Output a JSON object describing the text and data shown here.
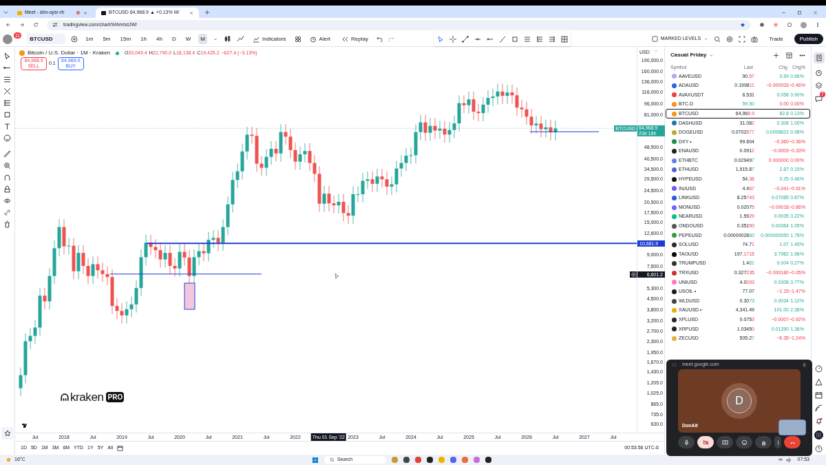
{
  "browser": {
    "tabs": [
      {
        "title": "Meet - sbn-oysr-rtr",
        "selected": false
      },
      {
        "title": "BTCUSD 64,968.9 ▲ +0.13% M/",
        "selected": true
      }
    ],
    "address": "tradingview.com/chart/94hmhdJW/"
  },
  "toolbar": {
    "avatar_badge": "11",
    "symbol": "BTCUSD",
    "intervals": [
      {
        "label": "1m",
        "selected": false
      },
      {
        "label": "5m",
        "selected": false
      },
      {
        "label": "15m",
        "selected": false
      },
      {
        "label": "1h",
        "selected": false
      },
      {
        "label": "4h",
        "selected": false
      },
      {
        "label": "D",
        "selected": false
      },
      {
        "label": "W",
        "selected": false
      },
      {
        "label": "M",
        "selected": true
      }
    ],
    "indicators": "Indicators",
    "alert": "Alert",
    "replay": "Replay",
    "layout_name": "MARKED LEVELS",
    "trade": "Trade",
    "publish": "Publish"
  },
  "chart": {
    "legend": {
      "title": "Bitcoin / U.S. Dollar · 1M · Kraken",
      "open_label": "O",
      "open": "20,049.4",
      "high_label": "H",
      "high": "22,790.0",
      "low_label": "L",
      "low": "18,138.4",
      "close_label": "C",
      "close": "19,425.2",
      "change": "−627.4 (−3.13%)"
    },
    "sell": {
      "price": "64,968.9",
      "label": "SELL"
    },
    "quantity": "0.1",
    "buy": {
      "price": "64,969.0",
      "label": "BUY"
    },
    "watermark": {
      "brand": "kraken",
      "badge": "PRO"
    },
    "currency": "USD",
    "y_ticks": [
      "190,000.0",
      "160,000.0",
      "136,000.0",
      "116,000.0",
      "96,000.0",
      "81,000.0",
      "48,500.0",
      "40,500.0",
      "34,500.0",
      "29,500.0",
      "24,500.0",
      "20,500.0",
      "17,500.0",
      "15,000.0",
      "12,600.0",
      "9,000.0",
      "7,500.0",
      "5,300.0",
      "4,500.0",
      "3,800.0",
      "3,200.0",
      "2,700.0",
      "2,300.0",
      "1,950.0",
      "1,670.0",
      "1,430.0",
      "1,205.0",
      "1,025.0",
      "865.0",
      "735.0",
      "630.0"
    ],
    "price_labels": [
      {
        "kind": "last",
        "symbol": "BTCUSD",
        "price": "64,968.9",
        "countdown": "23d 18h"
      },
      {
        "kind": "line",
        "price": "10,681.9"
      },
      {
        "kind": "cursor",
        "price": "6,601.2"
      }
    ],
    "x_ticks": [
      "Jul",
      "2018",
      "Jul",
      "2019",
      "Jul",
      "2020",
      "Jul",
      "2021",
      "Jul",
      "2022",
      "2023",
      "Jul",
      "2024",
      "Jul",
      "2025",
      "Jul",
      "2026",
      "Jul",
      "2027",
      "Jul"
    ],
    "hover_date": "Thu 01 Sep '22",
    "ranges": [
      "1D",
      "5D",
      "1M",
      "3M",
      "6M",
      "YTD",
      "1Y",
      "5Y",
      "All"
    ],
    "clock": "00:53:56 UTC-6"
  },
  "watchlist": {
    "title": "Casual Friday",
    "columns": [
      "Symbol",
      "Last",
      "Chg",
      "Chg%"
    ],
    "rows": [
      {
        "symbol": "AAVEUSD",
        "color": "#b6a7f0",
        "last": [
          {
            "text": "90."
          },
          {
            "text": "57",
            "falling": true
          }
        ],
        "chg": "0.59",
        "pct": "0.66%",
        "falling": false,
        "selected": false
      },
      {
        "symbol": "ADAUSD",
        "color": "#2563eb",
        "last": [
          {
            "text": "0.1998"
          },
          {
            "text": "11",
            "falling": true
          }
        ],
        "chg": "−0.000933",
        "pct": "−0.46%",
        "falling": true,
        "selected": false
      },
      {
        "symbol": "AVAXUSDT",
        "color": "#e84142",
        "last": [
          {
            "text": "6.531"
          }
        ],
        "chg": "0.058",
        "pct": "0.90%",
        "falling": false,
        "selected": false
      },
      {
        "symbol": "BTC.D",
        "color": "#f7931a",
        "last": [
          {
            "text": "59.50",
            "falling": false
          }
        ],
        "chg": "0.00",
        "pct": "0.00%",
        "falling": true,
        "selected": false
      },
      {
        "symbol": "BTCUSD",
        "color": "#f7931a",
        "last": [
          {
            "text": "64,96"
          },
          {
            "text": "8.9",
            "falling": true
          }
        ],
        "chg": "82.8",
        "pct": "0.13%",
        "falling": false,
        "selected": true
      },
      {
        "symbol": "DASHUSD",
        "color": "#1c75bc",
        "last": [
          {
            "text": "31.08"
          },
          {
            "text": "2",
            "falling": true
          }
        ],
        "chg": "0.308",
        "pct": "1.00%",
        "falling": false,
        "selected": false
      },
      {
        "symbol": "DOGEUSD",
        "color": "#c2a633",
        "last": [
          {
            "text": "0.0702"
          },
          {
            "text": "877",
            "falling": true
          }
        ],
        "chg": "0.0006821",
        "pct": "0.98%",
        "falling": false,
        "selected": false
      },
      {
        "symbol": "DXY •",
        "color": "#1e8c4e",
        "last": [
          {
            "text": "99.604"
          }
        ],
        "chg": "−0.360",
        "pct": "−0.36%",
        "falling": true,
        "selected": false
      },
      {
        "symbol": "ENAUSD",
        "color": "#222222",
        "last": [
          {
            "text": "0.091"
          },
          {
            "text": "2",
            "falling": true
          }
        ],
        "chg": "−0.0003",
        "pct": "−0.33%",
        "falling": true,
        "selected": false
      },
      {
        "symbol": "ETHBTC",
        "color": "#627eea",
        "last": [
          {
            "text": "0.02949"
          },
          {
            "text": "7",
            "falling": false
          }
        ],
        "chg": "0.000000",
        "pct": "0.00%",
        "falling": true,
        "selected": false
      },
      {
        "symbol": "ETHUSD",
        "color": "#4f63c8",
        "last": [
          {
            "text": "1,915.8"
          },
          {
            "text": "7",
            "falling": false
          }
        ],
        "chg": "2.87",
        "pct": "0.15%",
        "falling": false,
        "selected": false
      },
      {
        "symbol": "HYPEUSD",
        "color": "#111111",
        "last": [
          {
            "text": "54."
          },
          {
            "text": "38",
            "falling": true
          }
        ],
        "chg": "0.25",
        "pct": "0.46%",
        "falling": false,
        "selected": false
      },
      {
        "symbol": "INJUSD",
        "color": "#6f5af0",
        "last": [
          {
            "text": "4.4"
          },
          {
            "text": "67",
            "falling": true
          }
        ],
        "chg": "−0.041",
        "pct": "−0.91%",
        "falling": true,
        "selected": false
      },
      {
        "symbol": "LINKUSD",
        "color": "#2a5ada",
        "last": [
          {
            "text": "8.25"
          },
          {
            "text": "743",
            "falling": true
          }
        ],
        "chg": "0.07085",
        "pct": "0.87%",
        "falling": false,
        "selected": false
      },
      {
        "symbol": "MONUSD",
        "color": "#7c5cff",
        "last": [
          {
            "text": "0.0207"
          },
          {
            "text": "5",
            "falling": true
          }
        ],
        "chg": "−0.00018",
        "pct": "−0.86%",
        "falling": true,
        "selected": false
      },
      {
        "symbol": "NEARUSD",
        "color": "#00c08b",
        "last": [
          {
            "text": "1.59"
          },
          {
            "text": "29",
            "falling": true
          }
        ],
        "chg": "0.0035",
        "pct": "0.22%",
        "falling": false,
        "selected": false
      },
      {
        "symbol": "ONDOUSD",
        "color": "#555555",
        "last": [
          {
            "text": "0.351"
          },
          {
            "text": "50",
            "falling": true
          }
        ],
        "chg": "0.00364",
        "pct": "1.05%",
        "falling": false,
        "selected": false
      },
      {
        "symbol": "PEPEUSD",
        "color": "#3d9b35",
        "last": [
          {
            "text": "0.00000028"
          },
          {
            "text": "60",
            "falling": false
          }
        ],
        "chg": "0.000000050",
        "pct": "1.78%",
        "falling": false,
        "selected": false
      },
      {
        "symbol": "SOLUSD",
        "color": "#2b2b2b",
        "last": [
          {
            "text": "74.7"
          },
          {
            "text": "1",
            "falling": true
          }
        ],
        "chg": "1.07",
        "pct": "1.45%",
        "falling": false,
        "selected": false
      },
      {
        "symbol": "TAOUSD",
        "color": "#0a0a0a",
        "last": [
          {
            "text": "197."
          },
          {
            "text": "1715",
            "falling": true
          }
        ],
        "chg": "3.7982",
        "pct": "1.96%",
        "falling": false,
        "selected": false
      },
      {
        "symbol": "TRUMPUSD",
        "color": "#333333",
        "last": [
          {
            "text": "1.4"
          },
          {
            "text": "81",
            "falling": false
          }
        ],
        "chg": "0.004",
        "pct": "0.27%",
        "falling": false,
        "selected": false
      },
      {
        "symbol": "TRXUSD",
        "color": "#d32f2f",
        "last": [
          {
            "text": "0.327"
          },
          {
            "text": "235",
            "falling": true
          }
        ],
        "chg": "−0.000180",
        "pct": "−0.05%",
        "falling": true,
        "selected": false
      },
      {
        "symbol": "UNIUSD",
        "color": "#ff77b4",
        "last": [
          {
            "text": "4.0"
          },
          {
            "text": "093",
            "falling": true
          }
        ],
        "chg": "0.0308",
        "pct": "0.77%",
        "falling": false,
        "selected": false
      },
      {
        "symbol": "USOIL •",
        "color": "#1a1a1a",
        "last": [
          {
            "text": "77.07"
          }
        ],
        "chg": "−1.15",
        "pct": "−1.47%",
        "falling": true,
        "selected": false
      },
      {
        "symbol": "WLDUSD",
        "color": "#444444",
        "last": [
          {
            "text": "0.30"
          },
          {
            "text": "73",
            "falling": false
          }
        ],
        "chg": "0.0034",
        "pct": "1.12%",
        "falling": false,
        "selected": false
      },
      {
        "symbol": "XAUUSD •",
        "color": "#e5b100",
        "last": [
          {
            "text": "4,341.49"
          }
        ],
        "chg": "101.00",
        "pct": "2.38%",
        "falling": false,
        "selected": false
      },
      {
        "symbol": "XPLUSD",
        "color": "#262626",
        "last": [
          {
            "text": "0.075"
          },
          {
            "text": "3",
            "falling": true
          }
        ],
        "chg": "−0.0007",
        "pct": "−0.92%",
        "falling": true,
        "selected": false
      },
      {
        "symbol": "XRPUSD",
        "color": "#232323",
        "last": [
          {
            "text": "1.0345"
          },
          {
            "text": "0",
            "falling": true
          }
        ],
        "chg": "0.01390",
        "pct": "1.36%",
        "falling": false,
        "selected": false
      },
      {
        "symbol": "ZECUSD",
        "color": "#e8b03b",
        "last": [
          {
            "text": "505.2"
          },
          {
            "text": "7",
            "falling": false
          }
        ],
        "chg": "−6.35",
        "pct": "−1.24%",
        "falling": true,
        "selected": false
      }
    ]
  },
  "side_badge": "7",
  "meet": {
    "url": "meet.google.com",
    "initial": "D",
    "name": "DonAlt",
    "controls": [
      {
        "kind": "mic",
        "selected": false
      },
      {
        "kind": "camera",
        "selected": true
      },
      {
        "kind": "present",
        "selected": false
      },
      {
        "kind": "emoji",
        "selected": false
      },
      {
        "kind": "hand",
        "selected": false
      },
      {
        "kind": "more",
        "selected": false
      },
      {
        "kind": "hangup",
        "selected": false
      }
    ]
  },
  "taskbar": {
    "weather": "16°C",
    "search": "Search",
    "time": "07:53"
  }
}
